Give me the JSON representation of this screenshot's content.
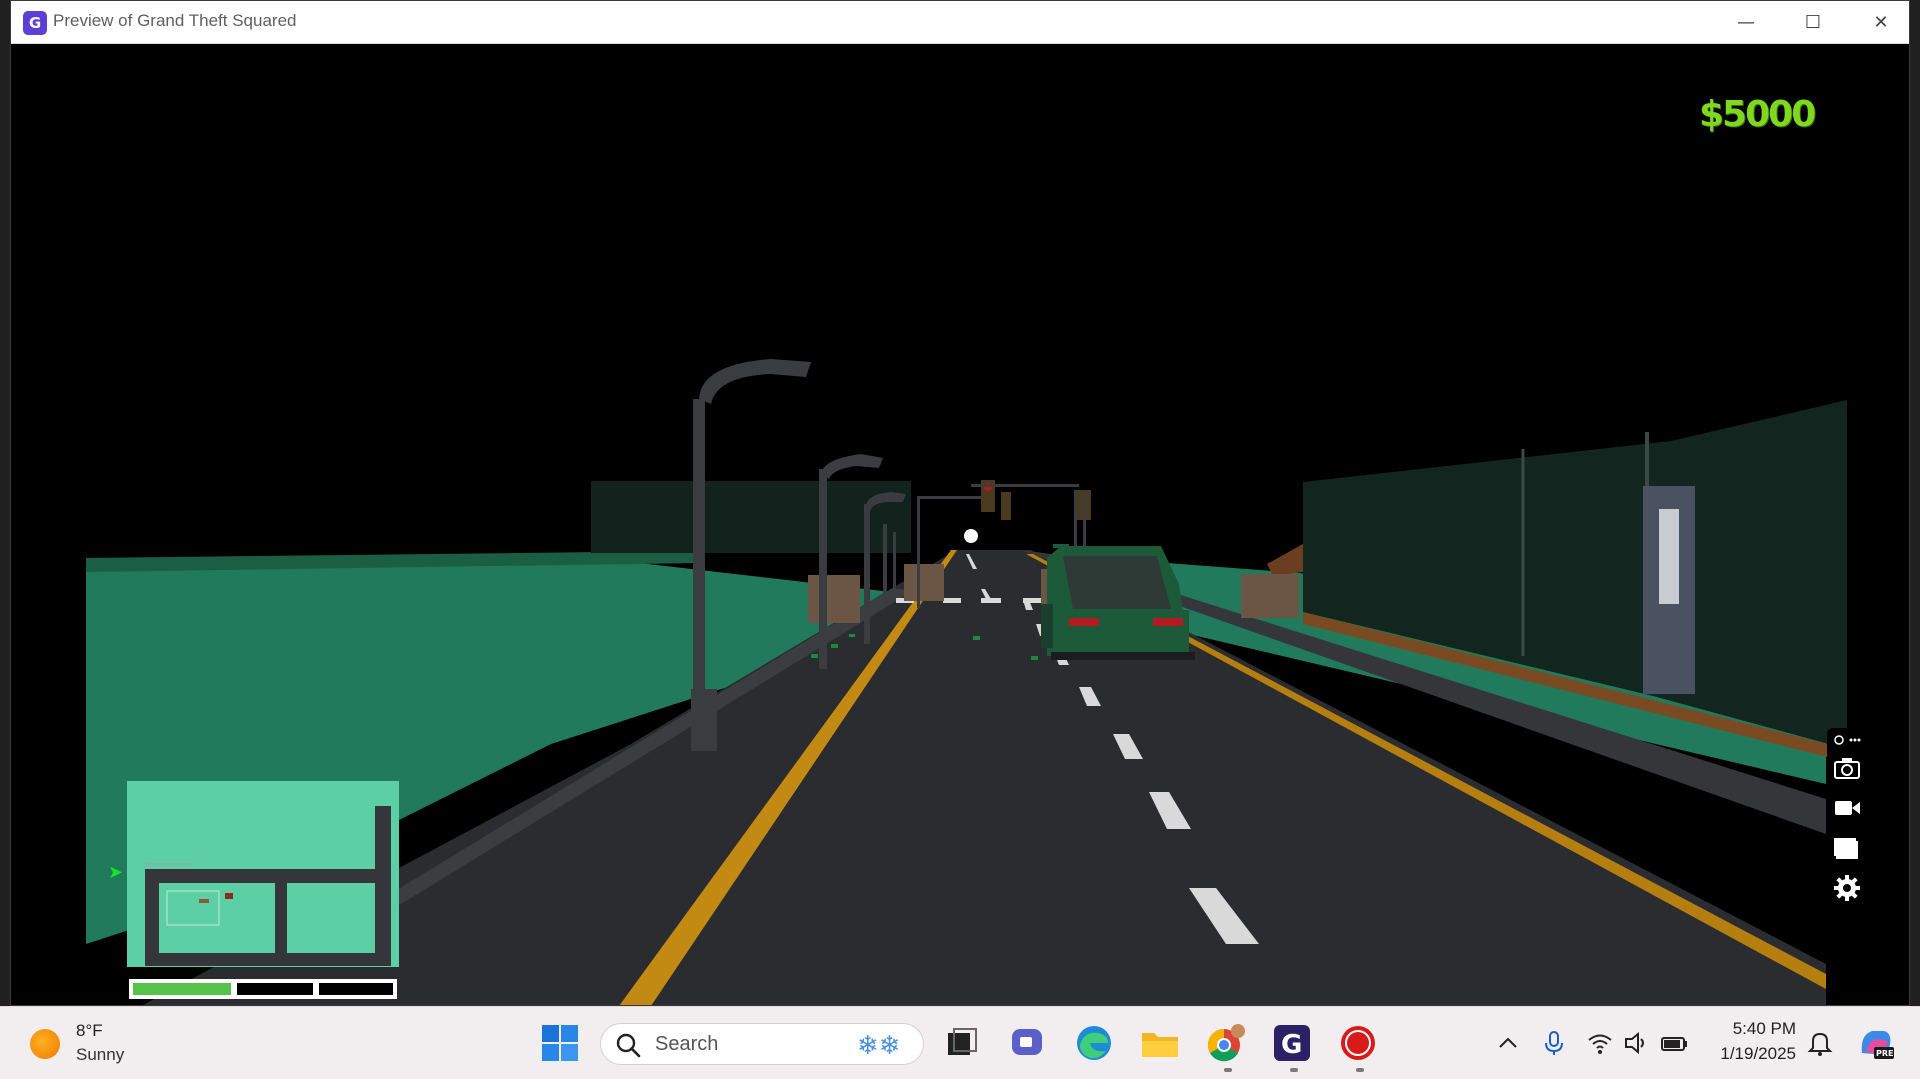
{
  "window": {
    "title": "Preview of Grand Theft Squared",
    "app_icon_glyph": "G",
    "minimize_glyph": "—",
    "maximize_glyph": "☐",
    "close_glyph": "✕"
  },
  "hud": {
    "money": "$5000",
    "money_color": "#7fd81d",
    "health_segments": [
      1,
      0,
      0
    ]
  },
  "minimap": {
    "background": "#5dcfa6",
    "player_marker_icon": "green-arrow-icon"
  },
  "recording_toolbar": {
    "items": [
      "link-icon",
      "camera-icon",
      "video-camera-icon",
      "window-icon",
      "gear-icon"
    ]
  },
  "taskbar": {
    "weather": {
      "temp": "8°F",
      "condition": "Sunny",
      "icon": "sun-icon"
    },
    "search": {
      "label": "Search",
      "icon": "search-icon"
    },
    "pinned": [
      "start-icon",
      "task-view-icon",
      "teams-icon",
      "edge-icon",
      "file-explorer-icon",
      "chrome-icon",
      "gdevelop-icon",
      "record-icon"
    ],
    "tray": [
      "chevron-up-icon",
      "microphone-icon",
      "wifi-icon",
      "speaker-icon",
      "battery-icon"
    ],
    "clock": {
      "time": "5:40 PM",
      "date": "1/19/2025"
    },
    "notifications_icon": "bell-icon",
    "copilot_icon": "copilot-icon",
    "copilot_badge": "PRE"
  },
  "colors": {
    "ground": "#227a5c",
    "road": "#2a2c30",
    "road_center_line": "#c28a12",
    "wall": "#12251f",
    "car": "#1d5a3a"
  }
}
